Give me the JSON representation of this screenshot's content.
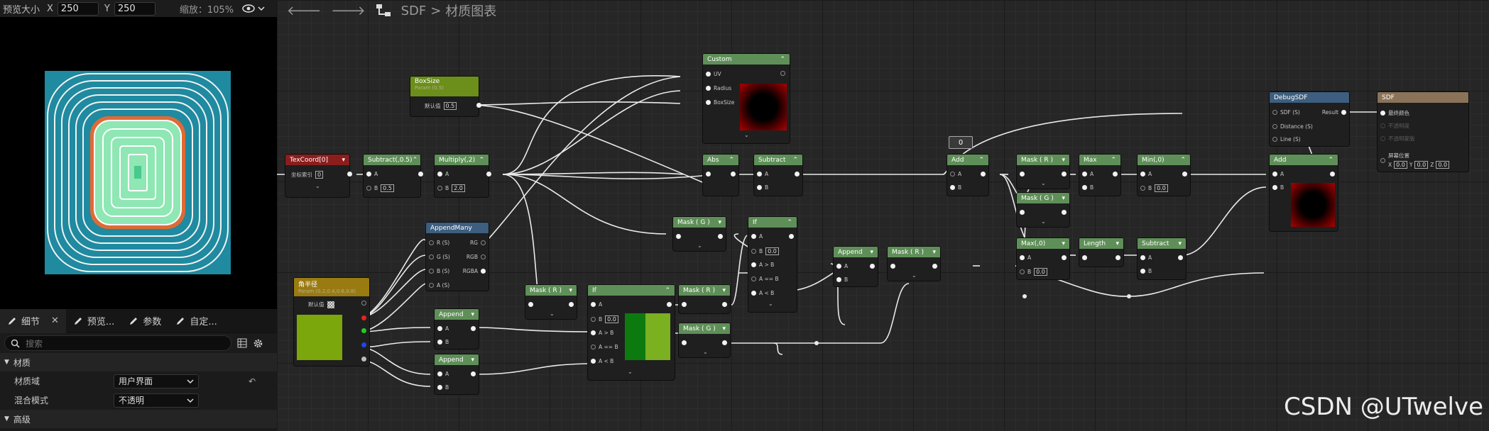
{
  "preview_toolbar": {
    "size_label": "预览大小",
    "x_label": "X",
    "x_value": "250",
    "y_label": "Y",
    "y_value": "250",
    "zoom_text": "缩放：105%"
  },
  "graph_header": {
    "breadcrumb_root": "SDF",
    "breadcrumb_separator": ">",
    "breadcrumb_current": "材质图表"
  },
  "details": {
    "tabs": [
      {
        "label": "细节",
        "active": true,
        "closable": true
      },
      {
        "label": "预览..."
      },
      {
        "label": "参数"
      },
      {
        "label": "自定..."
      }
    ],
    "search_placeholder": "搜索",
    "sections": {
      "material": "材质",
      "advanced": "高级"
    },
    "properties": [
      {
        "name": "材质域",
        "value": "用户界面"
      },
      {
        "name": "混合模式",
        "value": "不透明"
      }
    ]
  },
  "nodes": {
    "texcoord": {
      "title": "TexCoord[0]",
      "pin_label": "坐标索引",
      "value": "0"
    },
    "subtract1": {
      "title": "Subtract(,0.5)",
      "pin_a": "A",
      "pin_b": "B",
      "b_value": "0.5"
    },
    "multiply": {
      "title": "Multiply(,2)",
      "pin_a": "A",
      "pin_b": "B",
      "b_value": "2.0"
    },
    "boxsize": {
      "title": "BoxSize",
      "subtitle": "Param (0.5)",
      "pin_label": "默认值",
      "value": "0.5"
    },
    "custom": {
      "title": "Custom",
      "pins": [
        "UV",
        "Radius",
        "BoxSize"
      ]
    },
    "abs": {
      "title": "Abs"
    },
    "subtract2": {
      "title": "Subtract",
      "pin_a": "A",
      "pin_b": "B"
    },
    "add1": {
      "title": "Add",
      "pin_a": "A",
      "pin_b": "B",
      "badge": "0"
    },
    "maskr1": {
      "title": "Mask ( R )"
    },
    "maskg1": {
      "title": "Mask ( G )"
    },
    "max": {
      "title": "Max",
      "pin_a": "A",
      "pin_b": "B"
    },
    "min0": {
      "title": "Min(,0)",
      "pin_a": "A",
      "pin_b": "B",
      "b_value": "0.0"
    },
    "max0": {
      "title": "Max(,0)",
      "pin_a": "A",
      "pin_b": "B",
      "b_value": "0.0"
    },
    "length": {
      "title": "Length"
    },
    "subtract3": {
      "title": "Subtract",
      "pin_a": "A",
      "pin_b": "B"
    },
    "debugsdf": {
      "title": "DebugSDF",
      "pins": [
        "SDF (S)",
        "Distance (S)",
        "Line (S)"
      ],
      "output": "Result"
    },
    "add2": {
      "title": "Add",
      "pin_a": "A",
      "pin_b": "B"
    },
    "sdf_result": {
      "title": "SDF",
      "pins": [
        "最终颜色",
        "不透明度",
        "不透明蒙版"
      ],
      "screen_pos_label": "屏幕位置",
      "x_label": "X",
      "x_value": "0.0",
      "y_label": "Y",
      "y_value": "0.0",
      "z_label": "Z",
      "z_value": "0.0"
    },
    "appendmany": {
      "title": "AppendMany",
      "pins": [
        "R (S)",
        "G (S)",
        "B (S)",
        "A (S)"
      ],
      "outputs": [
        "RG",
        "RGB",
        "RGBA"
      ]
    },
    "radius_param": {
      "title": "角半径",
      "subtitle": "Param (0.2,0.4,0.6,0.8)",
      "pin_label": "默认值"
    },
    "append1": {
      "title": "Append",
      "pin_a": "A",
      "pin_b": "B"
    },
    "append2": {
      "title": "Append",
      "pin_a": "A",
      "pin_b": "B"
    },
    "maskr2": {
      "title": "Mask ( R )"
    },
    "if1": {
      "title": "If",
      "pins": [
        "A",
        "B",
        "A > B",
        "A == B",
        "A < B"
      ],
      "b_value": "0.0"
    },
    "maskr3": {
      "title": "Mask ( R )"
    },
    "maskg2": {
      "title": "Mask ( G )"
    },
    "maskg3": {
      "title": "Mask ( G )"
    },
    "if2": {
      "title": "If",
      "pins": [
        "A",
        "B",
        "A > B",
        "A == B",
        "A < B"
      ],
      "b_value": "0.0"
    },
    "append3": {
      "title": "Append",
      "pin_a": "A",
      "pin_b": "B"
    },
    "maskr4": {
      "title": "Mask ( R )"
    }
  },
  "watermark": "CSDN @UTwelve",
  "colors": {
    "green_header": "#5f8f58",
    "red_header": "#8c1d1d",
    "blue_header": "#3d5e7e",
    "teal": "#2aa0b2",
    "mint": "#7ee3a8",
    "orange_ring": "#e0703a"
  }
}
